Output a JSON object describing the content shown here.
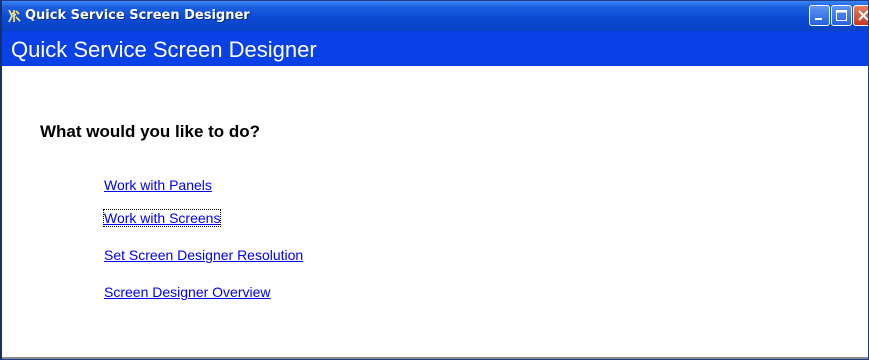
{
  "window": {
    "title": "Quick Service Screen Designer",
    "controls": {
      "minimize": "minimize-icon",
      "maximize": "maximize-icon",
      "close": "close-icon"
    }
  },
  "header": {
    "title": "Quick Service Screen Designer"
  },
  "main": {
    "prompt": "What would you like to do?",
    "links": [
      {
        "label": "Work with Panels"
      },
      {
        "label": "Work with Screens",
        "focused": true
      },
      {
        "label": "Set Screen Designer Resolution"
      },
      {
        "label": "Screen Designer Overview"
      }
    ]
  },
  "colors": {
    "titlebar": "#0a4bd5",
    "header_bg": "#0a41e6",
    "link": "#0000ee",
    "close_button": "#c3371c"
  }
}
